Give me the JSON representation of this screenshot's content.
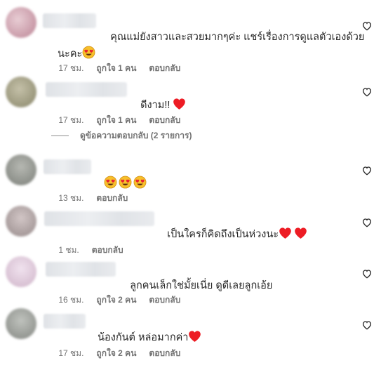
{
  "comments": [
    {
      "text_line1": "คุณแม่ยังสาวและสวยมากๆค่ะ แชร์เรื่องการดูแลตัวเองด้วย",
      "text_line2": "นะคะ",
      "time": "17 ชม.",
      "likes": "ถูกใจ 1 คน",
      "reply": "ตอบกลับ",
      "emojis": [
        "heart-eyes"
      ],
      "avatar_color": "#d9b5c0"
    },
    {
      "text_line1": "ดีงาม!!",
      "time": "17 ชม.",
      "likes": "ถูกใจ 1 คน",
      "reply": "ตอบกลับ",
      "emojis": [
        "red-heart"
      ],
      "avatar_color": "#a8a690"
    },
    {
      "text_line1": "",
      "time": "13 ชม.",
      "reply": "ตอบกลับ",
      "emojis": [
        "heart-eyes",
        "heart-eyes",
        "heart-eyes"
      ],
      "avatar_color": "#9ea09a"
    },
    {
      "text_line1": "เป็นใครก็คิดถึงเป็นห่วงนะ",
      "time": "1 ชม.",
      "reply": "ตอบกลับ",
      "emojis": [
        "red-heart",
        "red-heart"
      ],
      "avatar_color": "#b9aeae"
    },
    {
      "text_line1": "ลูกคนเล็กใช่มั้ยเนี่ย ดูดีเลยลูกเอ้ย",
      "time": "16 ชม.",
      "likes": "ถูกใจ 2 คน",
      "reply": "ตอบกลับ",
      "emojis": [],
      "avatar_color": "#e4d2e0"
    },
    {
      "text_line1": "น้องกันต์ หล่อมากค่า",
      "time": "17 ชม.",
      "likes": "ถูกใจ 2 คน",
      "reply": "ตอบกลับ",
      "emojis": [
        "red-heart"
      ],
      "avatar_color": "#a9aca7"
    }
  ],
  "view_replies": "ดูข้อความตอบกลับ (2 รายการ)",
  "icons": {
    "like": "heart-outline-icon",
    "heart_eyes": "heart-eyes-emoji",
    "red_heart": "red-heart-emoji"
  },
  "colors": {
    "text": "#262626",
    "meta": "#737373",
    "heart": "#ed1c24"
  }
}
